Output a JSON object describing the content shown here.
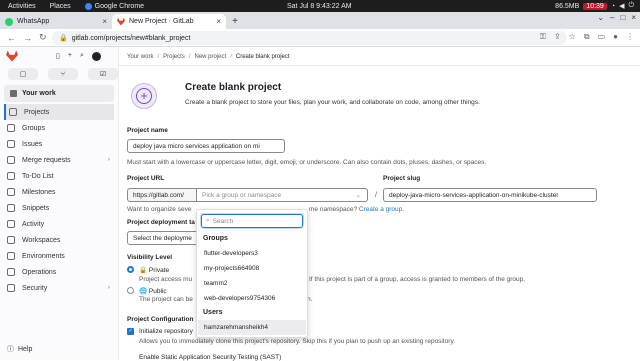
{
  "os": {
    "activities": "Activities",
    "places": "Places",
    "app": "Google Chrome",
    "datetime": "Sat Jul 8  9:43:22 AM",
    "network": "86.5MB",
    "battery": "10:39"
  },
  "tabs": [
    {
      "title": "WhatsApp"
    },
    {
      "title": "New Project · GitLab"
    }
  ],
  "address": {
    "url": "gitlab.com/projects/new#blank_project"
  },
  "sidebar": {
    "your_work": "Your work",
    "items": [
      {
        "label": "Projects"
      },
      {
        "label": "Groups"
      },
      {
        "label": "Issues"
      },
      {
        "label": "Merge requests"
      },
      {
        "label": "To-Do List"
      },
      {
        "label": "Milestones"
      },
      {
        "label": "Snippets"
      },
      {
        "label": "Activity"
      },
      {
        "label": "Workspaces"
      },
      {
        "label": "Environments"
      },
      {
        "label": "Operations"
      },
      {
        "label": "Security"
      }
    ],
    "help": "Help"
  },
  "breadcrumb": [
    "Your work",
    "Projects",
    "New project",
    "Create blank project"
  ],
  "page": {
    "title": "Create blank project",
    "description": "Create a blank project to store your files, plan your work, and collaborate on code, among other things."
  },
  "form": {
    "name_label": "Project name",
    "name_value": "deploy java micro services application on mi",
    "name_help": "Must start with a lowercase or uppercase letter, digit, emoji, or underscore. Can also contain dots, pluses, dashes, or spaces.",
    "url_label": "Project URL",
    "url_prefix": "https://gitlab.com/",
    "namespace_placeholder": "Pick a group or namespace",
    "slash": "/",
    "slug_label": "Project slug",
    "slug_value": "deploy-java-micro-services-application-on-minikube-cluster",
    "org_help_prefix": "Want to organize seve",
    "org_help_suffix": "me namespace?",
    "org_link": "Create a group.",
    "deploy_label": "Project deployment ta",
    "deploy_value": "Select the deployme",
    "visibility_label": "Visibility Level",
    "private_label": "Private",
    "private_help_1": "Project access mu",
    "private_help_2": "If this project is part of a group, access is granted to members of the group.",
    "public_label": "Public",
    "public_help_1": "The project can be",
    "public_help_2": "n.",
    "config_label": "Project Configuration",
    "init_repo_label": "Initialize repository",
    "init_repo_help": "Allows you to immediately clone this project's repository. Skip this if you plan to push up an existing repository.",
    "sast_label": "Enable Static Application Security Testing (SAST)"
  },
  "dropdown": {
    "search_placeholder": "Search",
    "groups_header": "Groups",
    "groups": [
      "flutter-developers3",
      "my-projects664908",
      "teamm2",
      "web-developers9754306"
    ],
    "users_header": "Users",
    "users": [
      "hamzarehmansheikh4"
    ]
  }
}
